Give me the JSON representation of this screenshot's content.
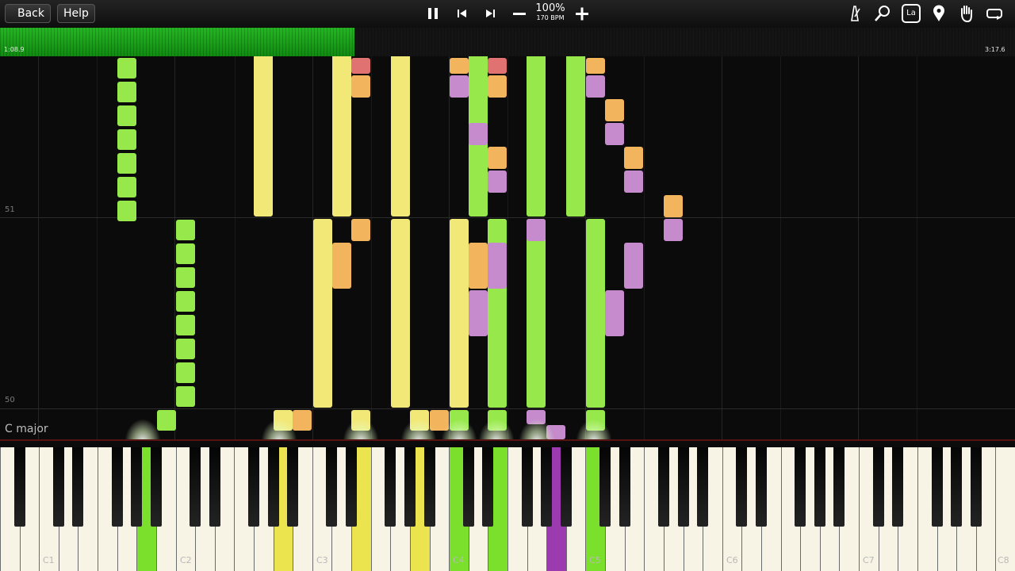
{
  "toolbar": {
    "back_label": "Back",
    "help_label": "Help",
    "zoom_value": "100%",
    "bpm_value": "170 BPM",
    "icons": [
      "pause-icon",
      "previous-icon",
      "next-icon",
      "minus-icon",
      "plus-icon",
      "metronome-icon",
      "search-icon",
      "note-label-icon",
      "pin-icon",
      "hand-icon",
      "loop-icon"
    ],
    "note_label_text": "La"
  },
  "progress": {
    "elapsed": "1:08.9",
    "total": "3:17.6",
    "fraction": 0.349,
    "color": "#1fb81d"
  },
  "roll": {
    "measures": [
      "51",
      "50"
    ],
    "key_signature": "C major"
  },
  "keyboard": {
    "octave_labels": [
      "C1",
      "C2",
      "C3",
      "C4",
      "C5",
      "C6",
      "C7",
      "C8"
    ]
  },
  "colors": {
    "green": "#96e84b",
    "yellow": "#f2e878",
    "orange": "#f2b45c",
    "purple": "#c58bcc",
    "red": "#e07372",
    "lime_key": "#7be02c",
    "yellow_key": "#ece44e",
    "purple_key": "#9c3bb0"
  }
}
